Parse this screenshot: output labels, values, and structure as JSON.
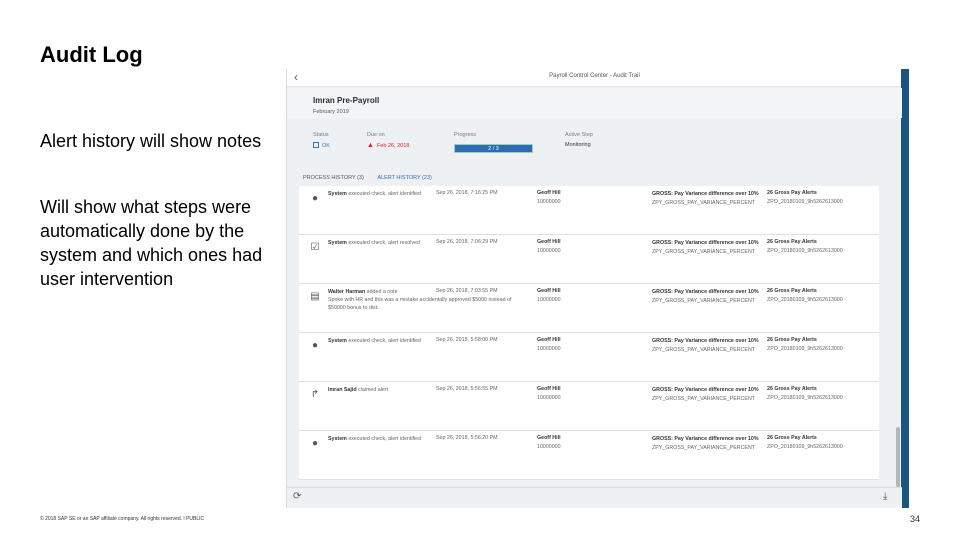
{
  "slide": {
    "title": "Audit Log",
    "bullet1": "Alert history will show notes",
    "bullet2": "Will show what steps were automatically done by the system and which ones had user intervention",
    "footer": "© 2018 SAP SE or an SAP affiliate company. All rights reserved.  ǀ  PUBLIC",
    "page_number": "34"
  },
  "app": {
    "title": "Payroll Control Center - Audit Trail",
    "employee": "Imran Pre-Payroll",
    "period": "February 2019",
    "status_label": "Status",
    "status_value": "OK",
    "due_label": "Due on",
    "due_value": "Feb 26, 2018",
    "progress_label": "Progress",
    "progress_value": "2 / 3",
    "active_step_label": "Active Step",
    "active_step_value": "Monitoring",
    "tab_process": "PROCESS HISTORY (3)",
    "tab_alert": "ALERT HISTORY (23)"
  },
  "rows": [
    {
      "icon": "info-icon",
      "actor": "System",
      "action": " executed check, alert identified",
      "note": "",
      "date": "Sep 26, 2018, 7:16:25 PM",
      "person": "Geoff Hill",
      "pernr": "10000000",
      "alert": "GROSS: Pay Variance difference over 10%",
      "code": "ZPY_GROSS_PAY_VARIANCE_PERCENT",
      "count": "26 Gross Pay Alerts",
      "ref": "ZPO_20180109_9h5262613000"
    },
    {
      "icon": "checkbox-icon",
      "actor": "System",
      "action": " executed check, alert resolved",
      "note": "",
      "date": "Sep 26, 2018, 7:06:29 PM",
      "person": "Geoff Hill",
      "pernr": "10000000",
      "alert": "GROSS: Pay Variance difference over 10%",
      "code": "ZPY_GROSS_PAY_VARIANCE_PERCENT",
      "count": "26 Gross Pay Alerts",
      "ref": "ZPO_20180109_9h5262613000"
    },
    {
      "icon": "note-icon",
      "actor": "Walter Harman",
      "action": " added a note",
      "note": "Spoke with HR and this was a mistake accidentally approved $5000 instead of $50000 bonus to dist.",
      "date": "Sep 26, 2018, 7:03:55 PM",
      "person": "Geoff Hill",
      "pernr": "10000000",
      "alert": "GROSS: Pay Variance difference over 10%",
      "code": "ZPY_GROSS_PAY_VARIANCE_PERCENT",
      "count": "26 Gross Pay Alerts",
      "ref": "ZPO_20180109_9h5262613000"
    },
    {
      "icon": "info-icon",
      "actor": "System",
      "action": " executed check, alert identified",
      "note": "",
      "date": "Sep 26, 2018, 5:58:00 PM",
      "person": "Geoff Hill",
      "pernr": "10000000",
      "alert": "GROSS: Pay Variance difference over 10%",
      "code": "ZPY_GROSS_PAY_VARIANCE_PERCENT",
      "count": "26 Gross Pay Alerts",
      "ref": "ZPO_20180109_9h5262613000"
    },
    {
      "icon": "forward-icon",
      "actor": "Imran Sajid",
      "action": " claimed alert",
      "note": "",
      "date": "Sep 26, 2018, 5:56:55 PM",
      "person": "Geoff Hill",
      "pernr": "10000000",
      "alert": "GROSS: Pay Variance difference over 10%",
      "code": "ZPY_GROSS_PAY_VARIANCE_PERCENT",
      "count": "26 Gross Pay Alerts",
      "ref": "ZPO_20180109_9h5262613000"
    },
    {
      "icon": "info-icon",
      "actor": "System",
      "action": " executed check, alert identified",
      "note": "",
      "date": "Sep 26, 2018, 5:56:20 PM",
      "person": "Geoff Hill",
      "pernr": "10000000",
      "alert": "GROSS: Pay Variance difference over 10%",
      "code": "ZPY_GROSS_PAY_VARIANCE_PERCENT",
      "count": "26 Gross Pay Alerts",
      "ref": "ZPO_20180109_9h5262613000"
    }
  ],
  "icons": {
    "back": "chevron-left-icon",
    "refresh": "refresh-icon",
    "download": "download-icon"
  },
  "colors": {
    "accent": "#2d6cb5",
    "edge": "#1a5582",
    "warning": "#dd2222"
  }
}
